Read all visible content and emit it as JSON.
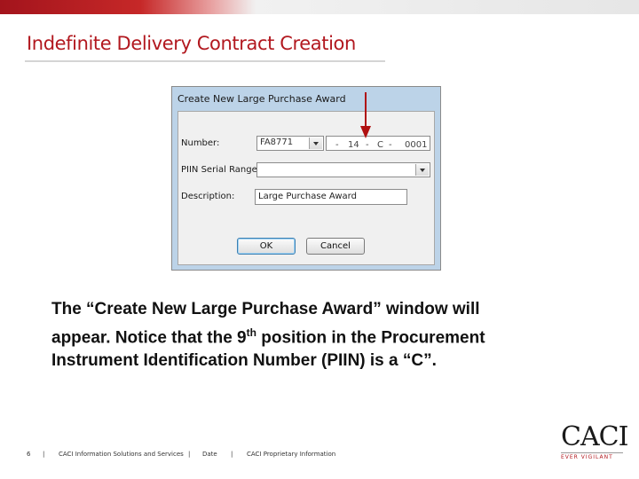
{
  "slide": {
    "title": "Indefinite Delivery Contract Creation",
    "body_line1": "The “Create New Large Purchase Award” window will",
    "body_line2_pre": "appear.  Notice that the 9",
    "body_line2_sup": "th",
    "body_line2_post": " position in the Procurement",
    "body_line3": "Instrument Identification Number (PIIN) is a “C”."
  },
  "dialog": {
    "caption": "Create New Large Purchase Award",
    "number_label": "Number:",
    "number_value": "FA8771",
    "seg_sep1": "-",
    "seg_year": "14",
    "seg_sep2": "-",
    "seg_type": "C",
    "seg_sep3": "-",
    "seg_serial": "0001",
    "piin_range_label": "PIIN Serial Range",
    "piin_range_value": "",
    "description_label": "Description:",
    "description_value": "Large Purchase Award",
    "ok_label": "OK",
    "cancel_label": "Cancel"
  },
  "footer": {
    "page_number": "6",
    "sep": "|",
    "company": "CACI Information Solutions and Services",
    "date": "Date",
    "proprietary": "CACI Proprietary Information"
  },
  "logo": {
    "wordmark": "CACI",
    "tagline": "EVER VIGILANT"
  },
  "colors": {
    "brand_red": "#b2181f",
    "dialog_frame": "#bcd3e8",
    "arrow": "#b01010"
  }
}
